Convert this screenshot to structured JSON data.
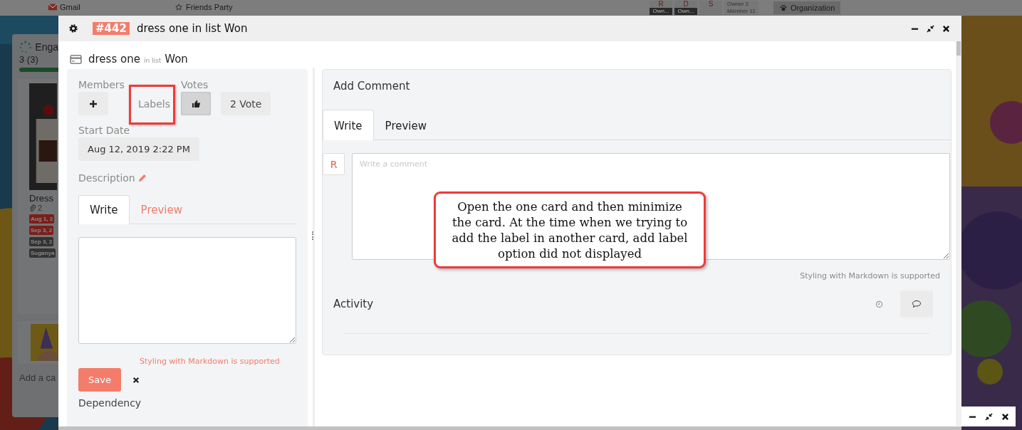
{
  "background": {
    "nav": [
      {
        "label": "Gmail"
      },
      {
        "label": "Friends Party"
      }
    ],
    "avatars": [
      {
        "initial": "R",
        "caption": "Own..."
      },
      {
        "initial": "D",
        "caption": "Own..."
      },
      {
        "initial": "S"
      }
    ],
    "counts": [
      "Owner 2",
      "Member 11"
    ],
    "org_menu": "Organization",
    "list": {
      "title": "Enga",
      "count": "3 (3)",
      "card_title": "Dress",
      "attachments": "2",
      "tags": [
        {
          "label": "Aug 1, 2",
          "color": "#7a1f1c"
        },
        {
          "label": "Sep 3, 2",
          "color": "#7a1f1c"
        },
        {
          "label": "Sep 3, 2",
          "color": "#333333"
        },
        {
          "label": "Suganya",
          "color": "#333333"
        }
      ],
      "add_card": "Add a ca"
    }
  },
  "modal": {
    "number": "#442",
    "title": "dress one in list Won",
    "card_name": "dress one",
    "in_list": "in list",
    "list_name": "Won",
    "members_label": "Members",
    "labels_label": "Labels",
    "votes_label": "Votes",
    "voted": true,
    "vote_count": "2 Vote",
    "start_date_label": "Start Date",
    "start_date": "Aug 12, 2019 2:22 PM",
    "description_label": "Description",
    "desc_tabs": [
      {
        "label": "Write",
        "selected": true
      },
      {
        "label": "Preview",
        "selected": false
      }
    ],
    "desc_hint": "Styling with Markdown is supported",
    "save": "Save",
    "dependency_label": "Dependency",
    "comment_title": "Add Comment",
    "comment_tabs": [
      {
        "label": "Write",
        "selected": true
      },
      {
        "label": "Preview",
        "selected": false
      }
    ],
    "avatar": "R",
    "comment_placeholder": "Write a comment",
    "comment_hint": "Styling with Markdown is supported",
    "activity_label": "Activity"
  },
  "annotation": {
    "text": "Open the one card and then minimize the card. At the time when we trying to add the label in another card, add label option did not displayed"
  }
}
